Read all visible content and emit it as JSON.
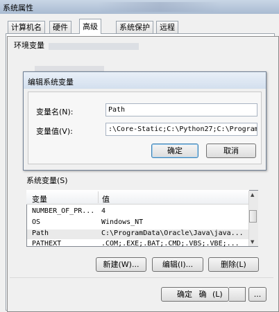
{
  "system_window": {
    "title": "系统属性",
    "tabs": [
      {
        "label": "计算机名"
      },
      {
        "label": "硬件"
      },
      {
        "label": "高级"
      },
      {
        "label": "系统保护"
      },
      {
        "label": "远程"
      }
    ]
  },
  "env_window": {
    "title": "环境变量",
    "system_vars_label": "系统变量(S)",
    "table": {
      "headers": [
        "变量",
        "值"
      ],
      "rows": [
        {
          "name": "NUMBER_OF_PR...",
          "value": "4"
        },
        {
          "name": "OS",
          "value": "Windows_NT"
        },
        {
          "name": "Path",
          "value": "C:\\ProgramData\\Oracle\\Java\\java..."
        },
        {
          "name": "PATHEXT",
          "value": ".COM;.EXE;.BAT;.CMD;.VBS;.VBE;..."
        }
      ]
    },
    "buttons": {
      "new": "新建(W)...",
      "edit": "编辑(I)...",
      "delete": "删除(L)",
      "ok": "确定",
      "cancel": "确",
      "cancel_accel": "(L)",
      "apply": "..."
    }
  },
  "edit_dialog": {
    "title": "编辑系统变量",
    "name_label": "变量名(N):",
    "name_value": "Path",
    "value_label": "变量值(V):",
    "value_value": ":\\Core-Static;C:\\Python27;C:\\Program",
    "ok": "确定",
    "cancel": "取消"
  }
}
